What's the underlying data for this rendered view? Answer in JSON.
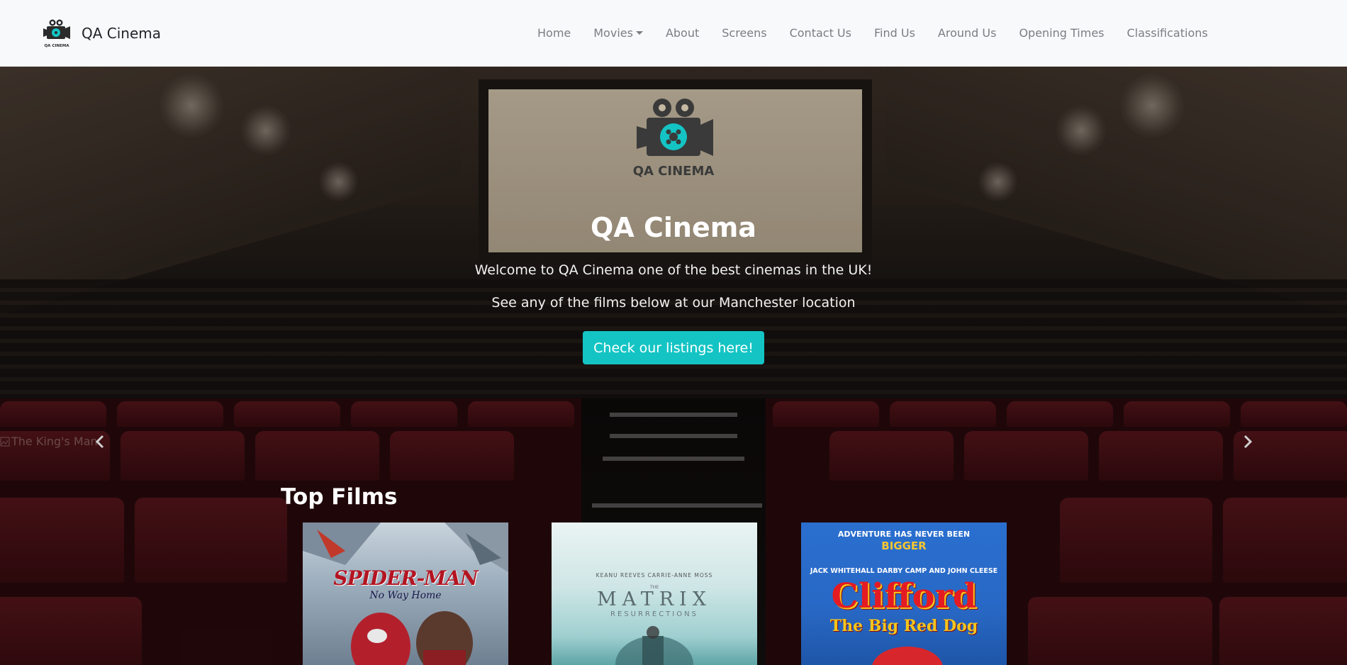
{
  "navbar": {
    "brand": "QA Cinema",
    "logo_caption": "QA CINEMA",
    "links": [
      "Home",
      "Movies",
      "About",
      "Screens",
      "Contact Us",
      "Find Us",
      "Around Us",
      "Opening Times",
      "Classifications"
    ]
  },
  "hero": {
    "logo_caption": "QA CINEMA",
    "title": "QA Cinema",
    "line1": "Welcome to QA Cinema one of the best cinemas in the UK!",
    "line2": "See any of the films below at our Manchester location",
    "button_label": "Check our listings here!"
  },
  "carousel": {
    "image_alt": "The King's Man"
  },
  "top_films": {
    "title": "Top Films",
    "posters": {
      "spiderman": {
        "title": "SPIDER-MAN",
        "subtitle": "No Way Home"
      },
      "matrix": {
        "actors": "KEANU REEVES    CARRIE-ANNE MOSS",
        "the": "THE",
        "title": "MATRIX",
        "subtitle": "RESURRECTIONS"
      },
      "clifford": {
        "tagline1": "ADVENTURE HAS NEVER BEEN",
        "tagline2": "BIGGER",
        "actors": "JACK WHITEHALL  DARBY CAMP  AND JOHN CLEESE",
        "title": "Clifford",
        "subtitle": "The Big Red Dog"
      }
    }
  },
  "colors": {
    "accent": "#14c4c4",
    "navbar_bg": "#f8f9fa",
    "nav_text": "#7a7e83"
  }
}
